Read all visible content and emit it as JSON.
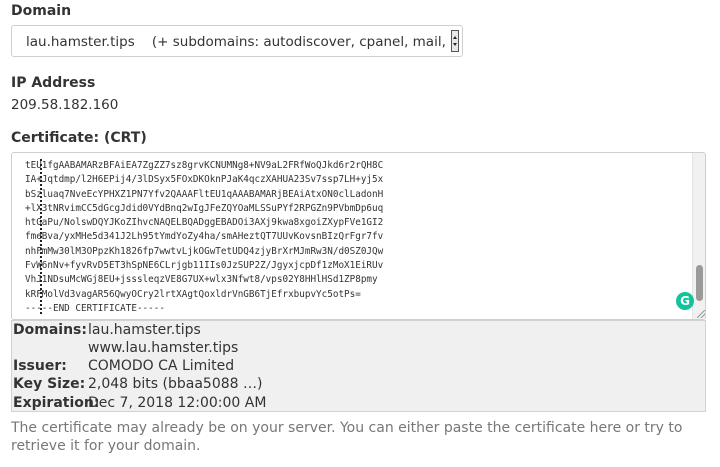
{
  "domain": {
    "label": "Domain",
    "selected": "lau.hamster.tips    (+ subdomains: autodiscover, cpanel, mail,"
  },
  "ip": {
    "label": "IP Address",
    "value": "209.58.182.160"
  },
  "certificate": {
    "label": "Certificate: (CRT)",
    "lines": [
      "tEU1fgAABAMARzBFAiEA7ZgZZ7sz8grvKCNUMNg8+NV9aL2FRfWoQJkd6r2rQH8C",
      "IA+Jqtdmp/l2H6EPij4/3lDSyx5FOxDKOknPJaK4qczXAHUA23Sv7ssp7LH+yj5x",
      "bSzluaq7NveEcYPHXZ1PN7Yfv2QAAAFltEU1qAAABAMARjBEAiAtxON0clLadonH",
      "+lX3tNRvimCC5dGcgJdid0VYdBnq2wIgJFeZQYOaMLSSuPYf2RPGZn9PVbmDp6uq",
      "htGaPu/NolswDQYJKoZIhvcNAQELBQADggEBADOi3AXj9kwa8xgoiZXypFVe1GI2",
      "fmeBva/yxMHe5d341J2Lh95tYmdYoZy4ha/smAHeztQT7UUvKovsnBIzQrFgr7fv",
      "nhFmMw30lM3OPpzKh1826fp7wwtvLjkOGwTetUDQ4zjyBrXrMJmRw3N/d0SZ0JQw",
      "FvW6nNv+fyvRvD5ET3hSpNE6CLrjgb11IIs0JzSUP2Z/JgyxjcpDf1zMoX1EiRUv",
      "VhJ1NDsuMcWGj8EU+jsssleqzVE8G7UX+wlx3Nfwt8/vps02Y8HHlHSd1ZP8pmy",
      "kRFMolVd3vagAR56QwyOCry2lrtXAgtQoxldrVnGB6TjEfrxbupvYc5otPs=",
      "-----END CERTIFICATE-----"
    ]
  },
  "details": {
    "domains_label": "Domains:",
    "domains": [
      "lau.hamster.tips",
      "www.lau.hamster.tips"
    ],
    "issuer_label": "Issuer:",
    "issuer": "COMODO CA Limited",
    "keysize_label": "Key Size:",
    "keysize": "2,048 bits (bbaa5088 …)",
    "expiration_label": "Expiration:",
    "expiration": "Dec 7, 2018 12:00:00 AM"
  },
  "help_text": "The certificate may already be on your server. You can either paste the certificate here or try to retrieve it for your domain.",
  "icons": {
    "grammarly": "grammarly-icon",
    "grammarly_glyph": "G",
    "grammarly_color": "#15c39a"
  }
}
